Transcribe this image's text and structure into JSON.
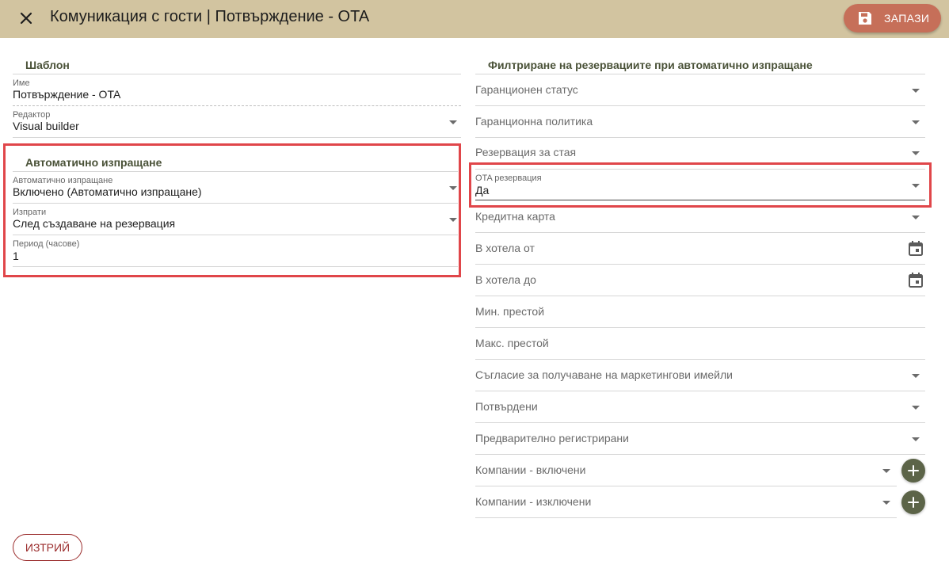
{
  "header": {
    "title": "Комуникация с гости | Потвърждение - OTA",
    "save_label": "ЗАПАЗИ"
  },
  "template_section": {
    "title": "Шаблон",
    "name_label": "Име",
    "name_value": "Потвърждение - OTA",
    "editor_label": "Редактор",
    "editor_value": "Visual builder"
  },
  "auto_send_section": {
    "title": "Автоматично изпращане",
    "auto_send_label": "Автоматично изпращане",
    "auto_send_value": "Включено (Автоматично изпращане)",
    "send_label": "Изпрати",
    "send_value": "След създаване на резервация",
    "period_label": "Период (часове)",
    "period_value": "1"
  },
  "filter_section": {
    "title": "Филтриране на резервациите при автоматично изпращане",
    "fields": {
      "guarantee_status": "Гаранционен статус",
      "guarantee_policy": "Гаранционна политика",
      "room_reservation": "Резервация за стая",
      "ota_label": "OTA резервация",
      "ota_value": "Да",
      "credit_card": "Кредитна карта",
      "in_hotel_from": "В хотела от",
      "in_hotel_to": "В хотела до",
      "min_stay": "Мин. престой",
      "max_stay": "Макс. престой",
      "marketing_consent": "Съгласие за получаване на маркетингови имейли",
      "confirmed": "Потвърдени",
      "preregistered": "Предварително регистрирани",
      "companies_included": "Компании - включени",
      "companies_excluded": "Компании - изключени"
    }
  },
  "footer": {
    "delete_label": "ИЗТРИЙ"
  },
  "colors": {
    "header_bg": "#d2c4a0",
    "save_button": "#c66f59",
    "section_title": "#4a5238",
    "highlight": "#e0464a",
    "add_button": "#5c6448",
    "delete_outline": "#9b2d2d"
  },
  "icons": {
    "close": "close-icon",
    "save": "floppy-disk-icon",
    "dropdown": "chevron-down-icon",
    "calendar": "calendar-icon",
    "add": "plus-icon"
  }
}
